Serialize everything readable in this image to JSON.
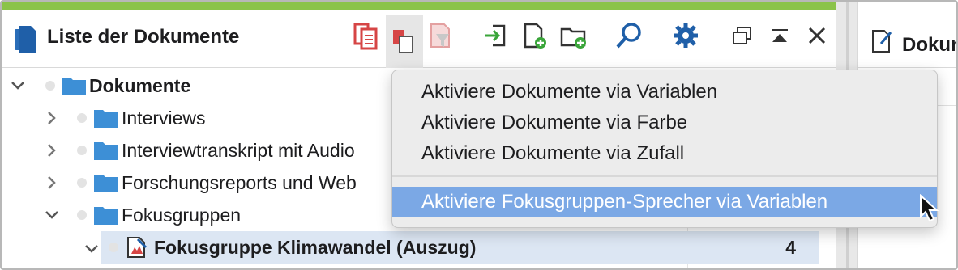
{
  "panel": {
    "title": "Liste der Dokumente"
  },
  "toolbar": {
    "icons": [
      "documents-list-icon",
      "copy-documents-icon",
      "activate-filter-icon",
      "import-icon",
      "new-document-icon",
      "new-folder-icon",
      "search-icon",
      "settings-gear-icon",
      "undock-window-icon",
      "maximize-icon",
      "close-icon"
    ]
  },
  "tree": {
    "root": "Dokumente",
    "items": [
      {
        "label": "Interviews"
      },
      {
        "label": "Interviewtranskript mit Audio"
      },
      {
        "label": "Forschungsreports und Web"
      },
      {
        "label": "Fokusgruppen"
      },
      {
        "label": "Fokusgruppe Klimawandel (Auszug)",
        "count": "4"
      }
    ]
  },
  "right_panel": {
    "title": "Dokument"
  },
  "menu": {
    "items": [
      "Aktiviere Dokumente via Variablen",
      "Aktiviere Dokumente via Farbe",
      "Aktiviere Dokumente via Zufall"
    ],
    "highlighted": "Aktiviere Fokusgruppen-Sprecher via Variablen"
  },
  "colors": {
    "accent_bar": "#8bc34a",
    "folder_blue": "#3d8fd6",
    "menu_highlight": "#7ba8e5",
    "selected_row": "#dce6f3"
  }
}
